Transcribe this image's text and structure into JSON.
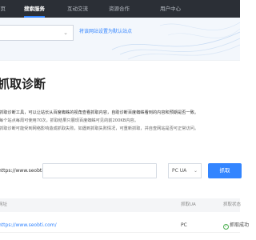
{
  "nav": {
    "items": [
      {
        "label": "首页",
        "active": false
      },
      {
        "label": "搜索服务",
        "active": true
      },
      {
        "label": "互动交流",
        "active": false
      },
      {
        "label": "资源合作",
        "active": false
      },
      {
        "label": "用户中心",
        "active": false
      }
    ]
  },
  "banner": {
    "site_select_chevron": "⌄",
    "default_site_link": "将该网站设置为默认站点"
  },
  "page": {
    "title": "抓取诊断",
    "desc_line1": "抓取诊断工具，可以让站长从百度蜘蛛的视角查看抓取内容，自助诊断百度蜘蛛看到的内容和预期是否一致。",
    "desc_line2": "每个站点每周可使用70次，抓取结果只展现百度蜘蛛可见的前200KB内容。",
    "desc_line3": "抓取诊断可能受到网络影响造成抓取失败，如遇到抓取失败情况，可重新抓取，并自查网站是否可正常访问。"
  },
  "fetch_form": {
    "url_prefix": "https://www.seobti.com/",
    "url_value": "",
    "ua_select": "PC UA",
    "ua_chevron": "⌄",
    "submit_label": "抓取"
  },
  "results": {
    "columns": {
      "url": "网址",
      "ua": "抓取UA",
      "status": "抓取状态"
    },
    "rows": [
      {
        "url": "https://www.seobti.com/",
        "ua": "PC",
        "status": "抓取成功",
        "status_icon": "check-circle-icon"
      }
    ]
  },
  "colors": {
    "accent": "#3385ff",
    "nav_bg": "#2b2f36",
    "success": "#4caf50"
  }
}
